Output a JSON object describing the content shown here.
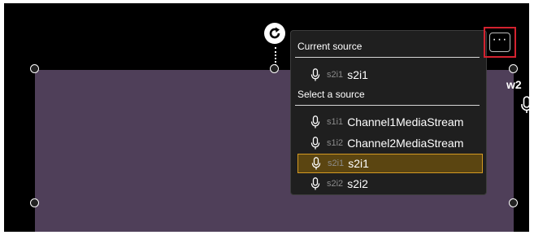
{
  "tile": {
    "label": "w2",
    "mic_icon": "microphone-icon",
    "background": "#4f3f59"
  },
  "rotate_icon": "rotate-icon",
  "more_button": {
    "label": "···",
    "icon": "more-options-icon",
    "highlight": "#d4222f"
  },
  "source_menu": {
    "current_heading": "Current source",
    "current": {
      "id": "s2i1",
      "name": "s2i1",
      "icon": "microphone-icon"
    },
    "select_heading": "Select a source",
    "sources": [
      {
        "id": "s1i1",
        "name": "Channel1MediaStream",
        "selected": false,
        "icon": "microphone-icon"
      },
      {
        "id": "s1i2",
        "name": "Channel2MediaStream",
        "selected": false,
        "icon": "microphone-icon"
      },
      {
        "id": "s2i1",
        "name": "s2i1",
        "selected": true,
        "icon": "microphone-icon"
      },
      {
        "id": "s2i2",
        "name": "s2i2",
        "selected": false,
        "icon": "microphone-icon"
      }
    ],
    "selected_color": "#d49a22"
  }
}
